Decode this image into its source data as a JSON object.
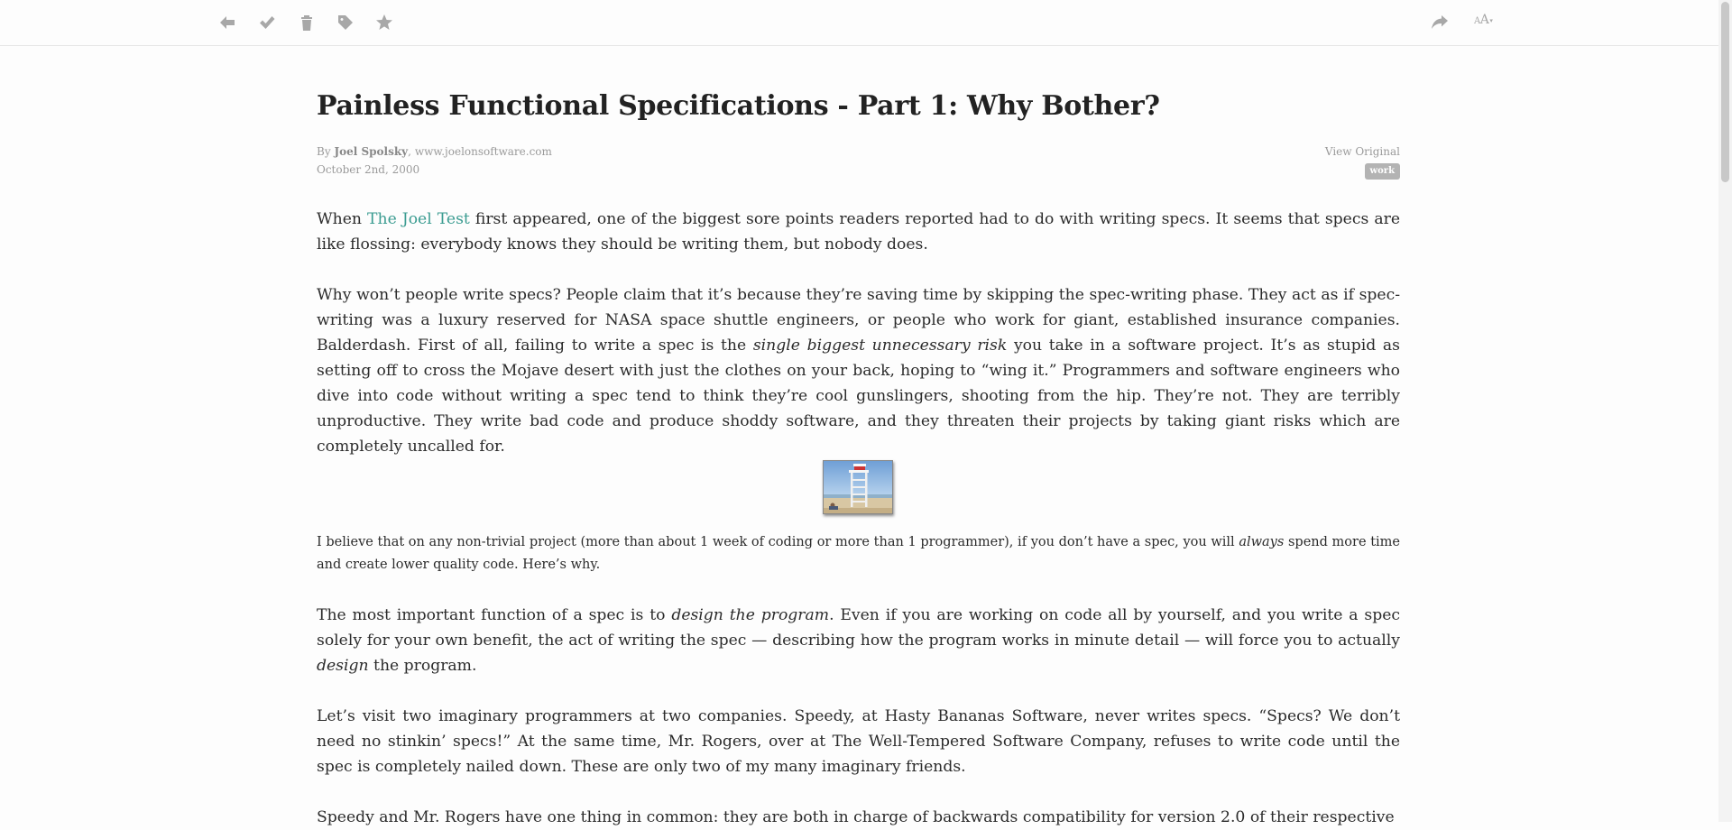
{
  "toolbar": {
    "left_icons": [
      {
        "name": "back-icon"
      },
      {
        "name": "checkmark-icon"
      },
      {
        "name": "trash-icon"
      },
      {
        "name": "tag-icon"
      },
      {
        "name": "star-icon"
      }
    ],
    "right_icons": [
      {
        "name": "share-icon"
      }
    ],
    "font_size_small": "A",
    "font_size_large": "A",
    "font_size_caret": "▾"
  },
  "article": {
    "title": "Painless Functional Specifications - Part 1: Why Bother?",
    "byline_prefix": "By",
    "author": "Joel Spolsky",
    "byline_sep": ",",
    "site": "www.joelonsoftware.com",
    "date": "October 2nd, 2000",
    "view_original": "View Original",
    "tag": "work",
    "image_alt_description": "lifeguard chair on beach",
    "p1": {
      "before": "When ",
      "link": "The Joel Test",
      "after": " first appeared, one of the biggest sore points readers reported had to do with writing specs. It seems that specs are like flossing: everybody knows they should be writing them, but nobody does."
    },
    "p2": {
      "part1": "Why won’t people write specs? People claim that it’s because they’re saving time by skipping the spec-writing phase. They act as if spec-writing was a luxury reserved for NASA space shuttle engineers, or people who work for giant, established insurance companies. Balderdash. First of all, failing to write a spec is the ",
      "em": "single biggest unnecessary risk",
      "part2": " you take in a software project. It’s as stupid as setting off to cross the Mojave desert with just the clothes on your back, hoping to “wing it.” Programmers and software engineers who dive into code without writing a spec tend to think they’re cool gunslingers, shooting from the hip. They’re not. They are terribly unproductive. They write bad code and produce shoddy software, and they threaten their projects by taking giant risks which are completely uncalled for."
    },
    "p3": {
      "part1": "I believe that on any non-trivial project (more than about 1 week of coding or more than 1 programmer), if you don’t have a spec, you will ",
      "em": "always",
      "part2": " spend more time and create lower quality code. Here’s why."
    },
    "p4": {
      "part1": "The most important function of a spec is to ",
      "em1": "design the program",
      "part2": ". Even if you are working on code all by yourself, and you write a spec solely for your own benefit, the act of writing the spec — describing how the program works in minute detail — will force you to actually ",
      "em2": "design",
      "part3": " the program."
    },
    "p5": "Let’s visit two imaginary programmers at two companies. Speedy, at Hasty Bananas Software, never writes specs. “Specs? We don’t need no stinkin’ specs!” At the same time, Mr. Rogers, over at The Well-Tempered Software Company, refuses to write code until the spec is completely nailed down. These are only two of my many imaginary friends.",
    "p6": "Speedy and Mr. Rogers have one thing in common: they are both in charge of backwards compatibility for version 2.0 of their respective"
  }
}
